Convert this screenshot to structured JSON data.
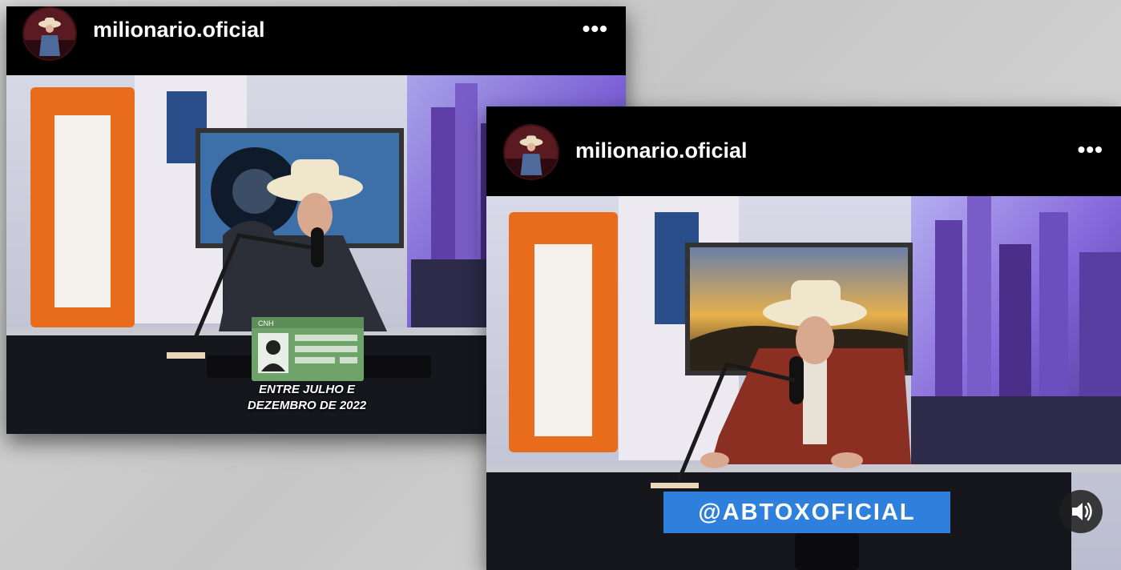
{
  "posts": [
    {
      "username": "milionario.oficial",
      "more_label": "•••",
      "avatar_icon": "profile-photo-icon",
      "caption_line1": "ENTRE JULHO E",
      "caption_line2": "DEZEMBRO DE 2022",
      "card_label": "CNH"
    },
    {
      "username": "milionario.oficial",
      "more_label": "•••",
      "avatar_icon": "profile-photo-icon",
      "tag_text": "@ABTOXOFICIAL",
      "sound_icon": "speaker-icon"
    }
  ],
  "colors": {
    "background": "#d3d3d3",
    "header": "#000000",
    "tag_blue": "#2f7fdc",
    "card_green": "#6fa36a"
  }
}
